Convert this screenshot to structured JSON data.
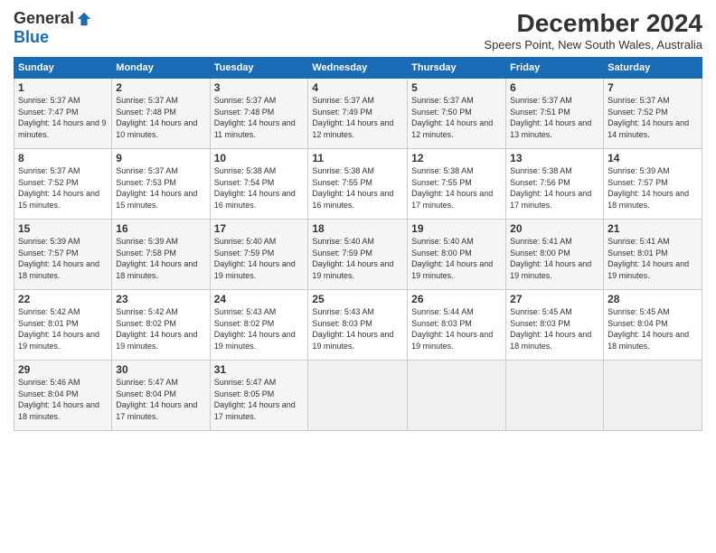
{
  "logo": {
    "general": "General",
    "blue": "Blue"
  },
  "header": {
    "title": "December 2024",
    "subtitle": "Speers Point, New South Wales, Australia"
  },
  "weekdays": [
    "Sunday",
    "Monday",
    "Tuesday",
    "Wednesday",
    "Thursday",
    "Friday",
    "Saturday"
  ],
  "weeks": [
    [
      {
        "day": "1",
        "sunrise": "5:37 AM",
        "sunset": "7:47 PM",
        "daylight": "14 hours and 9 minutes."
      },
      {
        "day": "2",
        "sunrise": "5:37 AM",
        "sunset": "7:48 PM",
        "daylight": "14 hours and 10 minutes."
      },
      {
        "day": "3",
        "sunrise": "5:37 AM",
        "sunset": "7:48 PM",
        "daylight": "14 hours and 11 minutes."
      },
      {
        "day": "4",
        "sunrise": "5:37 AM",
        "sunset": "7:49 PM",
        "daylight": "14 hours and 12 minutes."
      },
      {
        "day": "5",
        "sunrise": "5:37 AM",
        "sunset": "7:50 PM",
        "daylight": "14 hours and 12 minutes."
      },
      {
        "day": "6",
        "sunrise": "5:37 AM",
        "sunset": "7:51 PM",
        "daylight": "14 hours and 13 minutes."
      },
      {
        "day": "7",
        "sunrise": "5:37 AM",
        "sunset": "7:52 PM",
        "daylight": "14 hours and 14 minutes."
      }
    ],
    [
      {
        "day": "8",
        "sunrise": "5:37 AM",
        "sunset": "7:52 PM",
        "daylight": "14 hours and 15 minutes."
      },
      {
        "day": "9",
        "sunrise": "5:37 AM",
        "sunset": "7:53 PM",
        "daylight": "14 hours and 15 minutes."
      },
      {
        "day": "10",
        "sunrise": "5:38 AM",
        "sunset": "7:54 PM",
        "daylight": "14 hours and 16 minutes."
      },
      {
        "day": "11",
        "sunrise": "5:38 AM",
        "sunset": "7:55 PM",
        "daylight": "14 hours and 16 minutes."
      },
      {
        "day": "12",
        "sunrise": "5:38 AM",
        "sunset": "7:55 PM",
        "daylight": "14 hours and 17 minutes."
      },
      {
        "day": "13",
        "sunrise": "5:38 AM",
        "sunset": "7:56 PM",
        "daylight": "14 hours and 17 minutes."
      },
      {
        "day": "14",
        "sunrise": "5:39 AM",
        "sunset": "7:57 PM",
        "daylight": "14 hours and 18 minutes."
      }
    ],
    [
      {
        "day": "15",
        "sunrise": "5:39 AM",
        "sunset": "7:57 PM",
        "daylight": "14 hours and 18 minutes."
      },
      {
        "day": "16",
        "sunrise": "5:39 AM",
        "sunset": "7:58 PM",
        "daylight": "14 hours and 18 minutes."
      },
      {
        "day": "17",
        "sunrise": "5:40 AM",
        "sunset": "7:59 PM",
        "daylight": "14 hours and 19 minutes."
      },
      {
        "day": "18",
        "sunrise": "5:40 AM",
        "sunset": "7:59 PM",
        "daylight": "14 hours and 19 minutes."
      },
      {
        "day": "19",
        "sunrise": "5:40 AM",
        "sunset": "8:00 PM",
        "daylight": "14 hours and 19 minutes."
      },
      {
        "day": "20",
        "sunrise": "5:41 AM",
        "sunset": "8:00 PM",
        "daylight": "14 hours and 19 minutes."
      },
      {
        "day": "21",
        "sunrise": "5:41 AM",
        "sunset": "8:01 PM",
        "daylight": "14 hours and 19 minutes."
      }
    ],
    [
      {
        "day": "22",
        "sunrise": "5:42 AM",
        "sunset": "8:01 PM",
        "daylight": "14 hours and 19 minutes."
      },
      {
        "day": "23",
        "sunrise": "5:42 AM",
        "sunset": "8:02 PM",
        "daylight": "14 hours and 19 minutes."
      },
      {
        "day": "24",
        "sunrise": "5:43 AM",
        "sunset": "8:02 PM",
        "daylight": "14 hours and 19 minutes."
      },
      {
        "day": "25",
        "sunrise": "5:43 AM",
        "sunset": "8:03 PM",
        "daylight": "14 hours and 19 minutes."
      },
      {
        "day": "26",
        "sunrise": "5:44 AM",
        "sunset": "8:03 PM",
        "daylight": "14 hours and 19 minutes."
      },
      {
        "day": "27",
        "sunrise": "5:45 AM",
        "sunset": "8:03 PM",
        "daylight": "14 hours and 18 minutes."
      },
      {
        "day": "28",
        "sunrise": "5:45 AM",
        "sunset": "8:04 PM",
        "daylight": "14 hours and 18 minutes."
      }
    ],
    [
      {
        "day": "29",
        "sunrise": "5:46 AM",
        "sunset": "8:04 PM",
        "daylight": "14 hours and 18 minutes."
      },
      {
        "day": "30",
        "sunrise": "5:47 AM",
        "sunset": "8:04 PM",
        "daylight": "14 hours and 17 minutes."
      },
      {
        "day": "31",
        "sunrise": "5:47 AM",
        "sunset": "8:05 PM",
        "daylight": "14 hours and 17 minutes."
      },
      null,
      null,
      null,
      null
    ]
  ]
}
